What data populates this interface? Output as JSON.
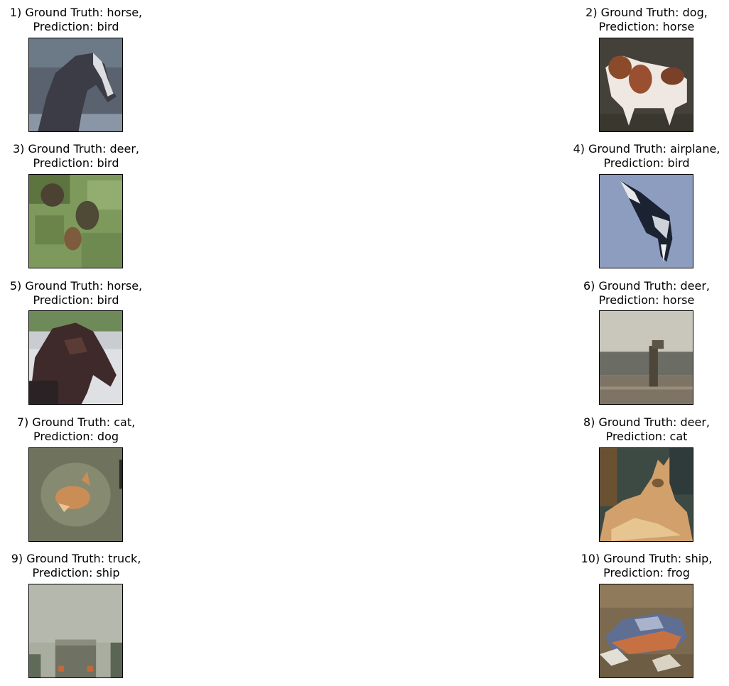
{
  "figure": {
    "panels": [
      {
        "line1": "1) Ground Truth: horse,",
        "line2": "Prediction: bird",
        "image": "horse-head-thumbnail"
      },
      {
        "line1": "2) Ground Truth: dog,",
        "line2": "Prediction: horse",
        "image": "dog-thumbnail"
      },
      {
        "line1": "3) Ground Truth: deer,",
        "line2": "Prediction: bird",
        "image": "deer-in-grass-thumbnail"
      },
      {
        "line1": "4) Ground Truth: airplane,",
        "line2": "Prediction: bird",
        "image": "airplane-thumbnail"
      },
      {
        "line1": "5) Ground Truth: horse,",
        "line2": "Prediction: bird",
        "image": "horse-head-thumbnail"
      },
      {
        "line1": "6) Ground Truth: deer,",
        "line2": "Prediction: horse",
        "image": "deer-thumbnail"
      },
      {
        "line1": "7) Ground Truth: cat,",
        "line2": "Prediction: dog",
        "image": "cat-thumbnail"
      },
      {
        "line1": "8) Ground Truth: deer,",
        "line2": "Prediction: cat",
        "image": "deer-lying-thumbnail"
      },
      {
        "line1": "9) Ground Truth: truck,",
        "line2": "Prediction: ship",
        "image": "truck-thumbnail"
      },
      {
        "line1": "10) Ground Truth: ship,",
        "line2": "Prediction: frog",
        "image": "boat-thumbnail"
      }
    ]
  }
}
